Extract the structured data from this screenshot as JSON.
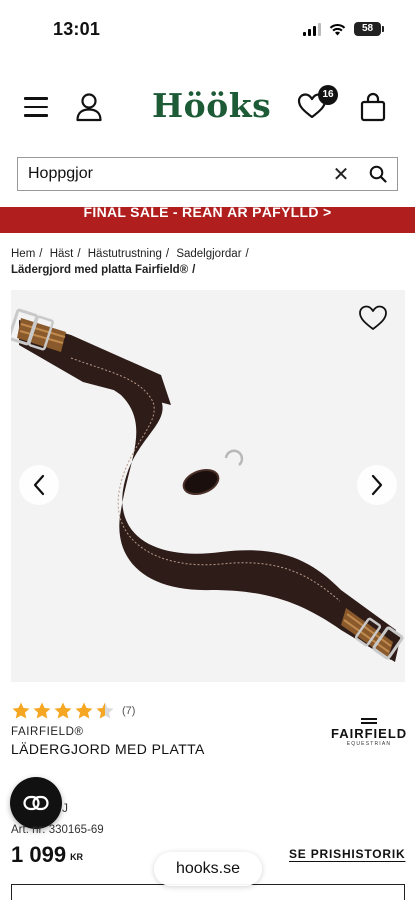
{
  "status": {
    "time": "13:01",
    "battery": "58"
  },
  "header": {
    "logo": "Hööks",
    "wishlist_count": "16"
  },
  "search": {
    "value": "Hoppgjor"
  },
  "banner": {
    "text": "FINAL SALE - REAN ÄR PÅFYLLD >"
  },
  "breadcrumb": {
    "items": [
      "Hem",
      "Häst",
      "Hästutrustning",
      "Sadelgjordar"
    ],
    "current": "Lädergjord med platta Fairfield®"
  },
  "product": {
    "rating": 4.5,
    "rating_count": "(7)",
    "brand": "FAIRFIELD®",
    "title": "LÄDERGJORD MED PLATTA",
    "brand_logo_name": "FAIRFIELD",
    "brand_logo_sub": "EQUESTRIAN",
    "partial_text": "J",
    "art_nr": "Art. nr: 330165-69",
    "price": "1 099",
    "currency": "KR",
    "price_history": "SE PRISHISTORIK"
  },
  "browser": {
    "url": "hooks.se"
  },
  "colors": {
    "brand_green": "#1d5a36",
    "banner_red": "#b01e1e",
    "star": "#f5a623"
  }
}
